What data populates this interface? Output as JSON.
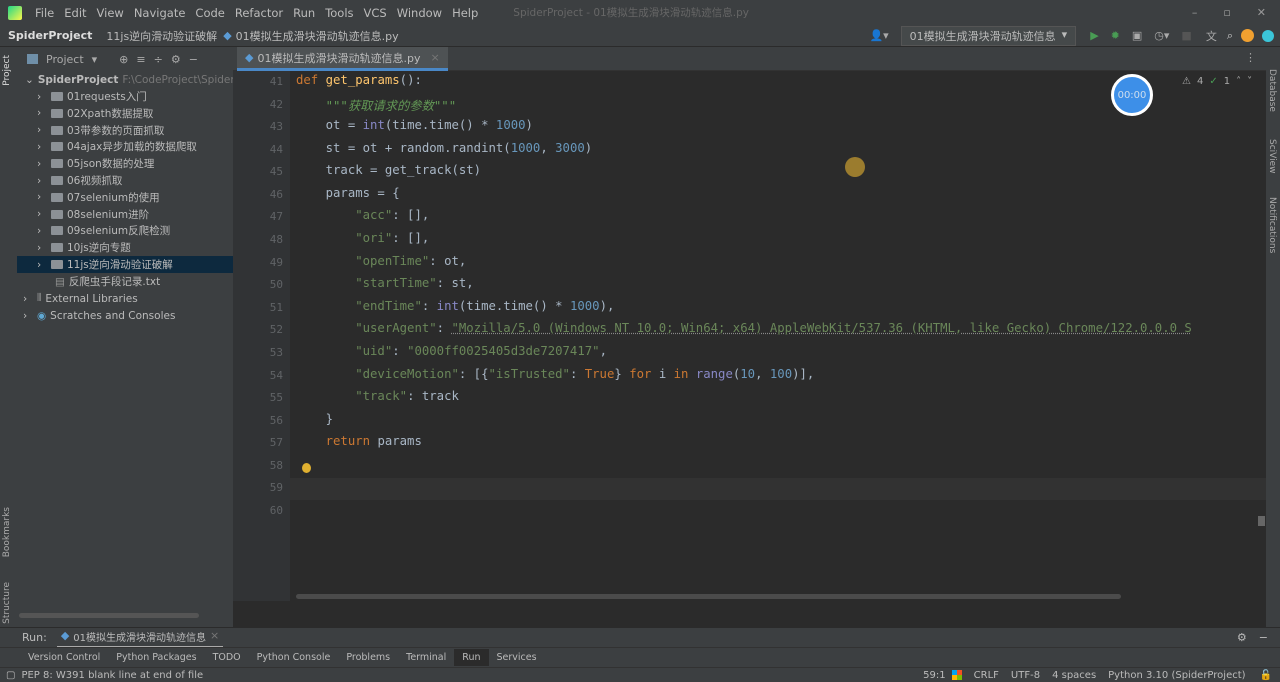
{
  "menu": [
    "File",
    "Edit",
    "View",
    "Navigate",
    "Code",
    "Refactor",
    "Run",
    "Tools",
    "VCS",
    "Window",
    "Help"
  ],
  "window_title": "SpiderProject - 01模拟生成滑块滑动轨迹信息.py",
  "breadcrumb": [
    "SpiderProject",
    "11js逆向滑动验证破解",
    "01模拟生成滑块滑动轨迹信息.py"
  ],
  "run_config": "01模拟生成滑块滑动轨迹信息",
  "project_panel": {
    "title": "Project",
    "root": "SpiderProject",
    "root_path": "F:\\CodeProject\\Spider",
    "items": [
      "01requests入门",
      "02Xpath数据提取",
      "03带参数的页面抓取",
      "04ajax异步加载的数据爬取",
      "05json数据的处理",
      "06视频抓取",
      "07selenium的使用",
      "08selenium进阶",
      "09selenium反爬检测",
      "10js逆向专题",
      "11js逆向滑动验证破解"
    ],
    "file": "反爬虫手段记录.txt",
    "external": "External Libraries",
    "scratches": "Scratches and Consoles"
  },
  "editor": {
    "tab": "01模拟生成滑块滑动轨迹信息.py",
    "warnings": "4",
    "checks": "1",
    "timer": "00:00",
    "lines": [
      {
        "no": "41",
        "t": [
          [
            "k",
            "def "
          ],
          [
            "f",
            "get_params"
          ],
          [
            "",
            "():"
          ]
        ]
      },
      {
        "no": "42",
        "t": [
          [
            "d",
            "    \"\"\"获取请求的参数\"\"\""
          ]
        ]
      },
      {
        "no": "43",
        "t": [
          [
            "",
            "    ot = "
          ],
          [
            "b",
            "int"
          ],
          [
            "",
            "(time.time() * "
          ],
          [
            "n",
            "1000"
          ],
          [
            "",
            ")"
          ]
        ]
      },
      {
        "no": "44",
        "t": [
          [
            "",
            "    st = ot + random.randint("
          ],
          [
            "n",
            "1000"
          ],
          [
            "",
            ", "
          ],
          [
            "n",
            "3000"
          ],
          [
            "",
            ")"
          ]
        ]
      },
      {
        "no": "45",
        "t": [
          [
            "",
            "    track = get_track(st)"
          ]
        ]
      },
      {
        "no": "46",
        "t": [
          [
            "",
            "    params = {"
          ]
        ]
      },
      {
        "no": "47",
        "t": [
          [
            "s",
            "        \"acc\""
          ],
          [
            "",
            ": [],"
          ]
        ]
      },
      {
        "no": "48",
        "t": [
          [
            "s",
            "        \"ori\""
          ],
          [
            "",
            ": [],"
          ]
        ]
      },
      {
        "no": "49",
        "t": [
          [
            "s",
            "        \"openTime\""
          ],
          [
            "",
            ": ot,"
          ]
        ]
      },
      {
        "no": "50",
        "t": [
          [
            "s",
            "        \"startTime\""
          ],
          [
            "",
            ": st,"
          ]
        ]
      },
      {
        "no": "51",
        "t": [
          [
            "s",
            "        \"endTime\""
          ],
          [
            "",
            ": "
          ],
          [
            "b",
            "int"
          ],
          [
            "",
            "(time.time() * "
          ],
          [
            "n",
            "1000"
          ],
          [
            "",
            "),"
          ]
        ]
      },
      {
        "no": "52",
        "t": [
          [
            "s",
            "        \"userAgent\""
          ],
          [
            "",
            ": "
          ],
          [
            "s w",
            "\"Mozilla/5.0 (Windows NT 10.0; Win64; x64) AppleWebKit/537.36 (KHTML, like Gecko) Chrome/122.0.0.0 S"
          ]
        ]
      },
      {
        "no": "53",
        "t": [
          [
            "s",
            "        \"uid\""
          ],
          [
            "",
            ": "
          ],
          [
            "s",
            "\"0000ff0025405d3de7207417\""
          ],
          [
            "",
            ","
          ]
        ]
      },
      {
        "no": "54",
        "t": [
          [
            "s",
            "        \"deviceMotion\""
          ],
          [
            "",
            ": [{"
          ],
          [
            "s",
            "\"isTrusted\""
          ],
          [
            "",
            ": "
          ],
          [
            "k",
            "True"
          ],
          [
            "",
            "} "
          ],
          [
            "k",
            "for "
          ],
          [
            "",
            "i "
          ],
          [
            "k",
            "in "
          ],
          [
            "b",
            "range"
          ],
          [
            "",
            "("
          ],
          [
            "n",
            "10"
          ],
          [
            "",
            ", "
          ],
          [
            "n",
            "100"
          ],
          [
            "",
            ")],"
          ]
        ]
      },
      {
        "no": "55",
        "t": [
          [
            "s",
            "        \"track\""
          ],
          [
            "",
            ": track"
          ]
        ]
      },
      {
        "no": "56",
        "t": [
          [
            "",
            "    }"
          ]
        ]
      },
      {
        "no": "57",
        "t": [
          [
            "k",
            "    return "
          ],
          [
            "",
            "params"
          ]
        ]
      },
      {
        "no": "58",
        "t": []
      },
      {
        "no": "59",
        "t": []
      },
      {
        "no": "60",
        "t": []
      }
    ]
  },
  "run": {
    "label": "Run:",
    "tab": "01模拟生成滑块滑动轨迹信息"
  },
  "tool_windows": [
    "Version Control",
    "Python Packages",
    "TODO",
    "Python Console",
    "Problems",
    "Terminal",
    "Run",
    "Services"
  ],
  "side": {
    "left": [
      "Project",
      "Bookmarks",
      "Structure"
    ],
    "right": [
      "Database",
      "SciView",
      "Notifications"
    ]
  },
  "status": {
    "message": "PEP 8: W391 blank line at end of file",
    "position": "59:1",
    "line_sep": "CRLF",
    "encoding": "UTF-8",
    "indent": "4 spaces",
    "interpreter": "Python 3.10 (SpiderProject)"
  }
}
